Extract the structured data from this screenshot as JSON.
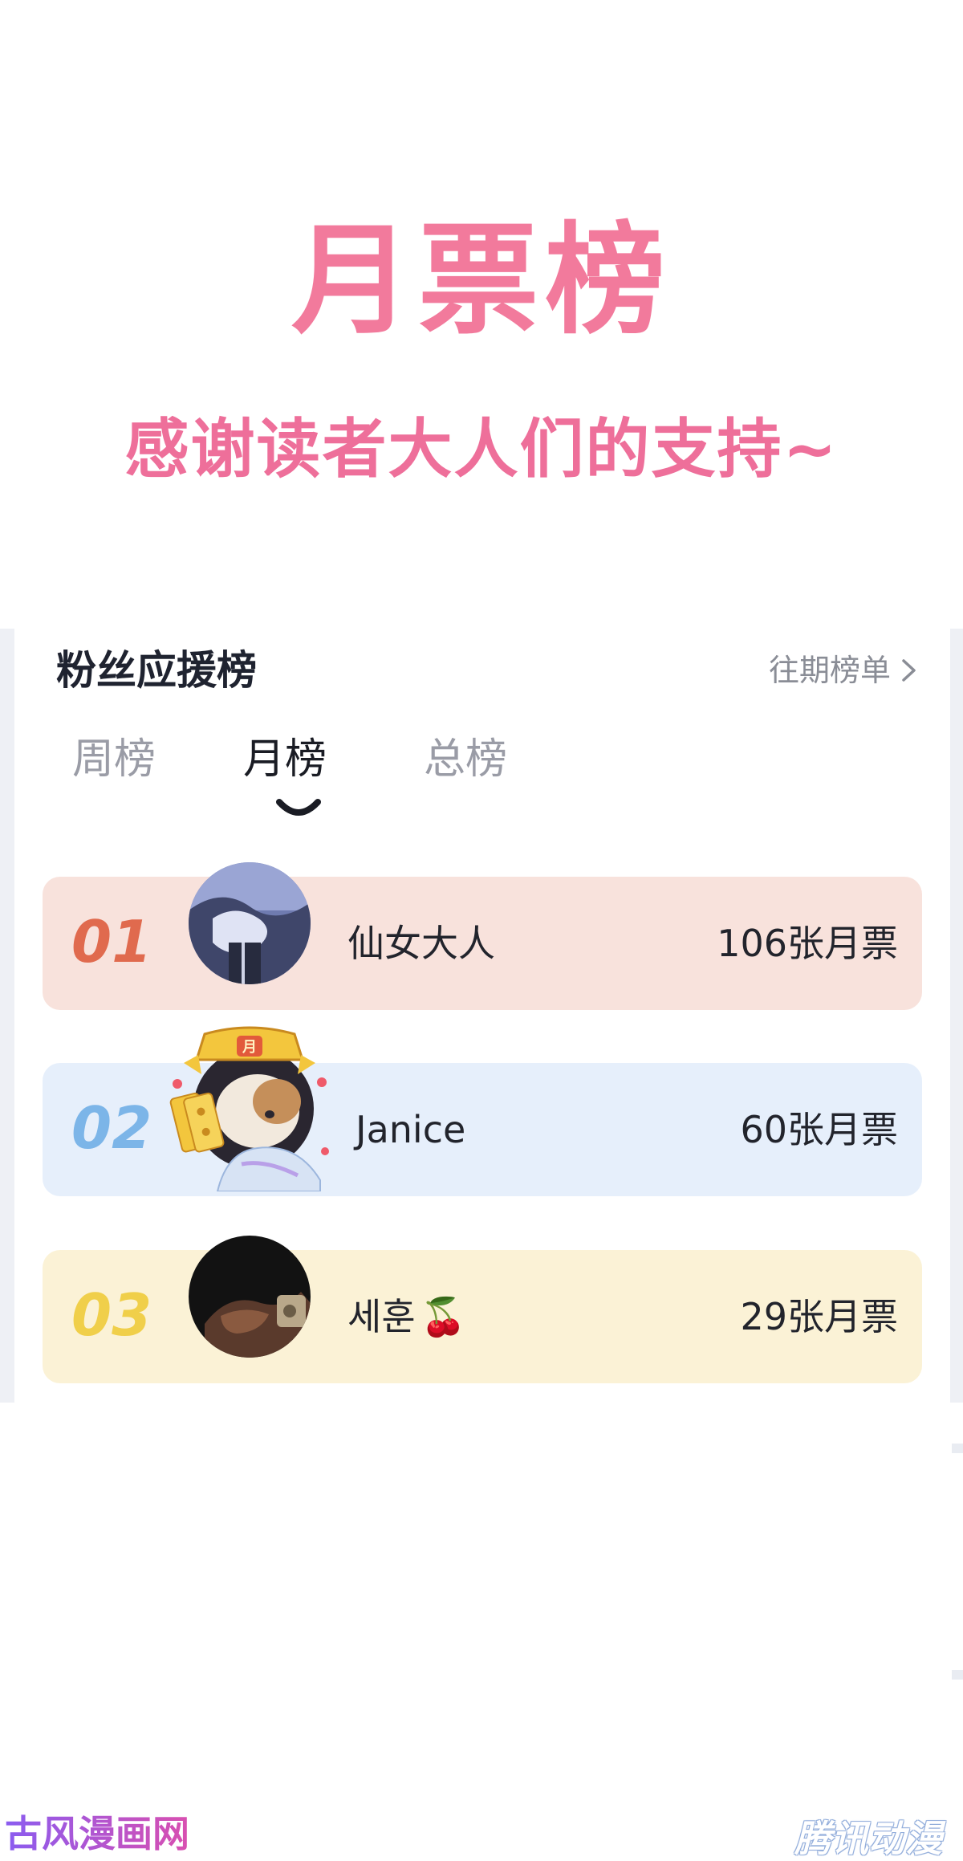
{
  "banner": {
    "title": "月票榜",
    "subtitle": "感谢读者大人们的支持~"
  },
  "fan_board": {
    "heading": "粉丝应援榜",
    "history_link": "往期榜单",
    "tabs": [
      {
        "label": "周榜",
        "active": false
      },
      {
        "label": "月榜",
        "active": true
      },
      {
        "label": "总榜",
        "active": false
      }
    ],
    "entries": [
      {
        "rank": "01",
        "name": "仙女大人",
        "votes": "106张月票",
        "name_emoji": ""
      },
      {
        "rank": "02",
        "name": "Janice",
        "votes": "60张月票",
        "name_emoji": ""
      },
      {
        "rank": "03",
        "name": "세훈",
        "votes": "29张月票",
        "name_emoji": "🍒"
      }
    ]
  },
  "watermarks": {
    "left": "古风漫画网",
    "right": "腾讯动漫"
  },
  "colors": {
    "title_pink": "#f27a9c",
    "subtitle_pink": "#ee6f9a",
    "row1_bg": "#f8e2dc",
    "row1_rank": "#e06a4e",
    "row2_bg": "#e6effb",
    "row2_rank": "#7cb5e8",
    "row3_bg": "#fbf2d6",
    "row3_rank": "#f0cf4a"
  }
}
